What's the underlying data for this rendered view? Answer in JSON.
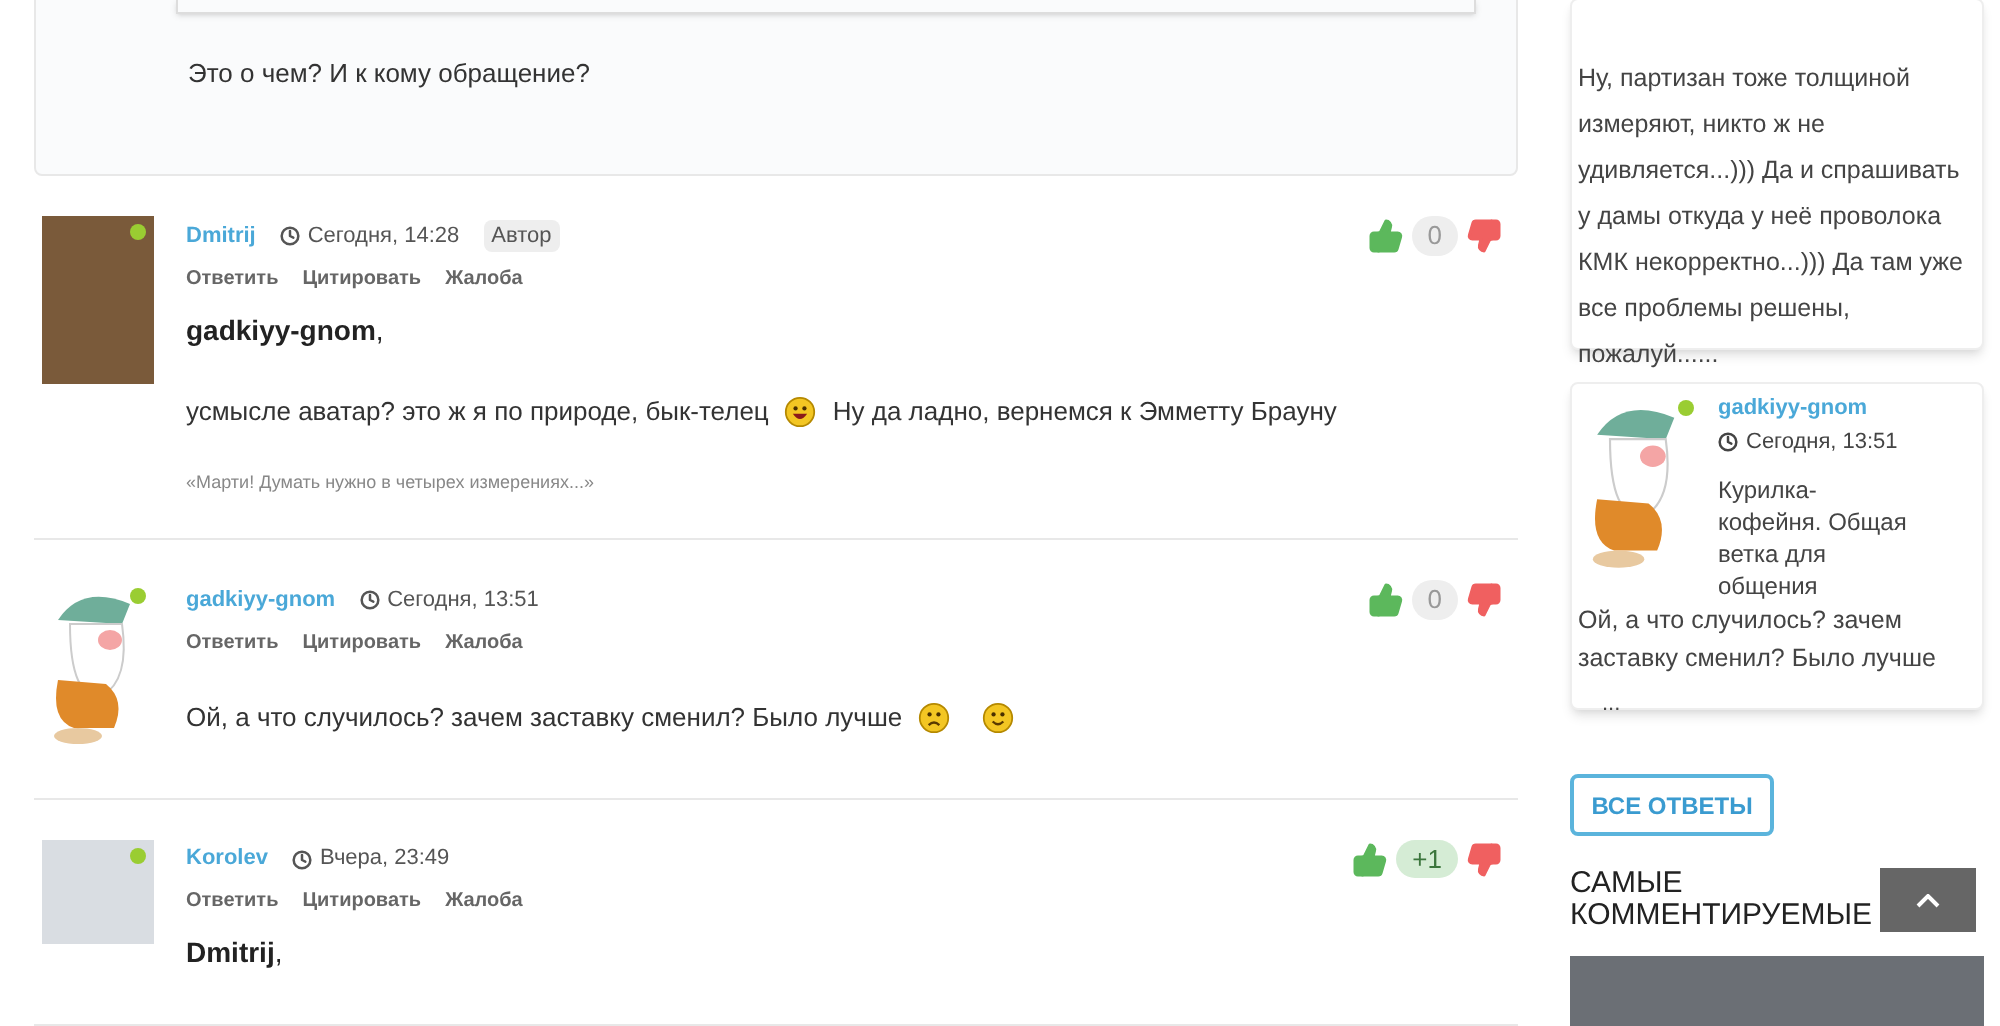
{
  "comments": [
    {
      "kind": "partial",
      "body": [
        [
          {
            "kind": "text",
            "text": "Это о чем? И к кому обращение?"
          }
        ]
      ]
    },
    {
      "kind": "full",
      "author": "Dmitrij",
      "avatar": {
        "kind": "photo"
      },
      "online": true,
      "time": "Сегодня, 14:28",
      "badge": "Автор",
      "actions": [
        "Ответить",
        "Цитировать",
        "Жалоба"
      ],
      "addressee": "**gadkiyy-gnom**,",
      "body": [
        [
          {
            "kind": "text",
            "text": "усмысле аватар? это ж я по природе, бык-телец"
          },
          {
            "kind": "laugh"
          },
          {
            "kind": "text",
            "text": "Ну да ладно, вернемся к Эмметту Брауну"
          }
        ]
      ],
      "signature": "«Марти! Думать нужно в четырех измерениях...»",
      "score": "0",
      "positive": false
    },
    {
      "kind": "full",
      "author": "gadkiyy-gnom",
      "avatar": {
        "kind": "gnome"
      },
      "online": true,
      "time": "Сегодня, 13:51",
      "actions": [
        "Ответить",
        "Цитировать",
        "Жалоба"
      ],
      "body": [
        [
          {
            "kind": "text",
            "text": "Ой, а что случилось? зачем заставку сменил? Было лучше"
          },
          {
            "kind": "sad"
          },
          {
            "kind": "smile"
          }
        ]
      ],
      "score": "0",
      "positive": false
    },
    {
      "kind": "full",
      "author": "Korolev",
      "avatar": {
        "kind": "sketch"
      },
      "online": true,
      "time": "Вчера, 23:49",
      "actions": [
        "Ответить",
        "Цитировать",
        "Жалоба"
      ],
      "addressee": "**Dmitrij**,",
      "score": "+1",
      "positive": true
    }
  ],
  "sidebar": {
    "replies": [
      {
        "kind": "partial",
        "text": "Ну, партизан тоже толщиной измеряют, никто ж не удивляется...))) Да и спрашивать у дамы откуда у неё проволока КМК некорректно...))) Да там уже все проблемы решены, пожалуй......"
      },
      {
        "kind": "full",
        "author": "gadkiyy-gnom",
        "online": true,
        "time": "Сегодня, 13:51",
        "topic": "Курилка-кофейня. Общая ветка для общения",
        "text": "Ой, а что случилось? зачем заставку сменил? Было лучше",
        "more": "..."
      }
    ],
    "all_button": "ВСЕ ОТВЕТЫ",
    "heading": "САМЫЕ КОММЕНТИРУЕМЫЕ"
  }
}
